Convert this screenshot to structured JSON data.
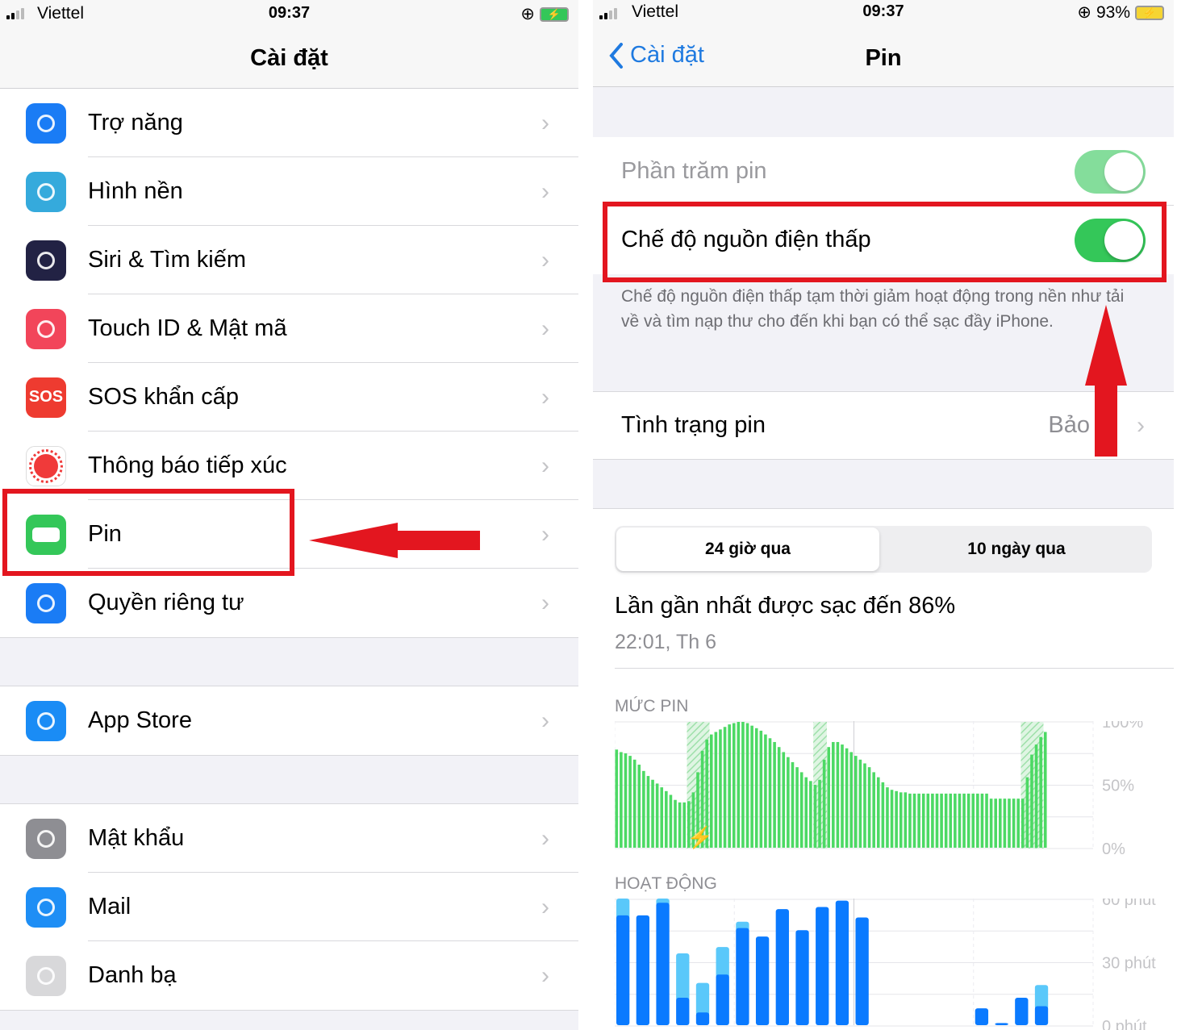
{
  "left": {
    "status": {
      "carrier": "Viettel",
      "time": "09:37"
    },
    "title": "Cài đặt",
    "groups": [
      [
        {
          "label": "Trợ năng",
          "icon": "accessibility-icon",
          "color": "#1a7cf5"
        },
        {
          "label": "Hình nền",
          "icon": "wallpaper-flower-icon",
          "color": "#35aadc"
        },
        {
          "label": "Siri & Tìm kiếm",
          "icon": "siri-icon",
          "color": "#222244"
        },
        {
          "label": "Touch ID & Mật mã",
          "icon": "fingerprint-icon",
          "color": "#f2455a"
        },
        {
          "label": "SOS khẩn cấp",
          "icon": "sos-icon",
          "color": "#ee3b30",
          "glyph": "SOS"
        },
        {
          "label": "Thông báo tiếp xúc",
          "icon": "exposure-notification-icon",
          "color": "#ffffff"
        },
        {
          "label": "Pin",
          "icon": "battery-icon",
          "color": "#34c759"
        },
        {
          "label": "Quyền riêng tư",
          "icon": "hand-privacy-icon",
          "color": "#1a7cf5"
        }
      ],
      [
        {
          "label": "App Store",
          "icon": "app-store-icon",
          "color": "#1a8cf5"
        }
      ],
      [
        {
          "label": "Mật khẩu",
          "icon": "key-icon",
          "color": "#8e8e93"
        },
        {
          "label": "Mail",
          "icon": "mail-icon",
          "color": "#1e8ef5"
        },
        {
          "label": "Danh bạ",
          "icon": "contacts-icon",
          "color": "#d8d8da"
        }
      ]
    ]
  },
  "right": {
    "status": {
      "carrier": "Viettel",
      "time": "09:37",
      "battery": "93%"
    },
    "back_label": "Cài đặt",
    "title": "Pin",
    "battery_percentage": {
      "label": "Phần trăm pin",
      "on": true
    },
    "low_power": {
      "label": "Chế độ nguồn điện thấp",
      "on": true
    },
    "low_power_footer": "Chế độ nguồn điện thấp tạm thời giảm hoạt động trong nền như tải về và tìm nạp thư cho đến khi bạn có thể sạc đầy iPhone.",
    "battery_health": {
      "label": "Tình trạng pin",
      "value": "Bảo"
    },
    "segments": [
      "24 giờ qua",
      "10 ngày qua"
    ],
    "selected_segment": 0,
    "last_charged": "Lần gần nhất được sạc đến 86%",
    "last_charged_time": "22:01, Th 6",
    "accent": "#1f7ae0"
  },
  "chart_data": [
    {
      "type": "bar",
      "title": "MỨC PIN",
      "y_ticks": [
        "100%",
        "50%",
        "0%"
      ],
      "ylim": [
        0,
        100
      ],
      "color": "#4cd964",
      "values": [
        78,
        76,
        75,
        73,
        70,
        66,
        61,
        57,
        54,
        51,
        48,
        45,
        42,
        38,
        36,
        36,
        37,
        44,
        60,
        77,
        86,
        90,
        92,
        94,
        96,
        98,
        99,
        100,
        100,
        99,
        97,
        95,
        93,
        90,
        87,
        84,
        80,
        76,
        72,
        68,
        64,
        60,
        56,
        53,
        50,
        54,
        70,
        80,
        84,
        84,
        82,
        79,
        76,
        73,
        70,
        67,
        64,
        60,
        56,
        52,
        48,
        46,
        45,
        44,
        44,
        43,
        43,
        43,
        43,
        43,
        43,
        43,
        43,
        43,
        43,
        43,
        43,
        43,
        43,
        43,
        43,
        43,
        43,
        39,
        39,
        39,
        39,
        39,
        39,
        39,
        39,
        56,
        74,
        82,
        88,
        92
      ],
      "charging_ranges": [
        [
          16,
          20
        ],
        [
          44,
          46
        ],
        [
          90,
          94
        ]
      ]
    },
    {
      "type": "bar",
      "title": "HOẠT ĐỘNG",
      "y_ticks": [
        "60 phút",
        "30 phút",
        "0 phút"
      ],
      "ylim": [
        0,
        60
      ],
      "colors": [
        "#0a7aff",
        "#5ac8fa"
      ],
      "series": [
        {
          "values": [
            52,
            52,
            58,
            13,
            6,
            24,
            46,
            42,
            55,
            45,
            56,
            59,
            51,
            0,
            0,
            0,
            0,
            0,
            8,
            1,
            13,
            9,
            0,
            0
          ]
        },
        {
          "values": [
            8,
            0,
            2,
            21,
            14,
            13,
            3,
            0,
            0,
            0,
            0,
            0,
            0,
            0,
            0,
            0,
            0,
            0,
            0,
            0,
            0,
            10,
            0,
            0
          ]
        }
      ]
    }
  ]
}
